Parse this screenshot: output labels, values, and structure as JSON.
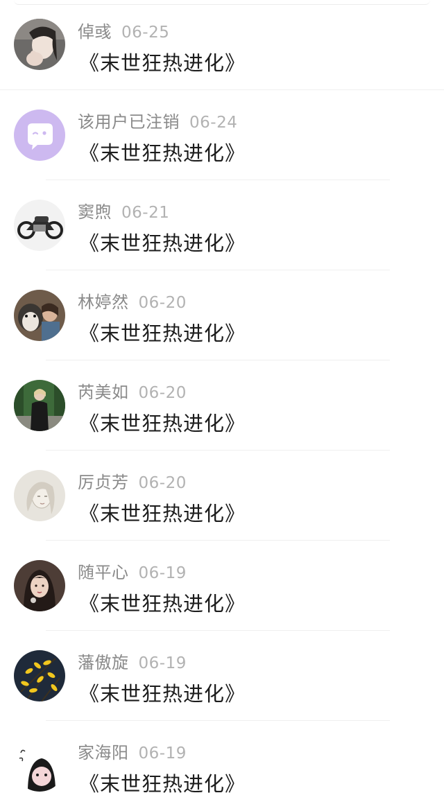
{
  "feed": {
    "items": [
      {
        "name": "倬彧",
        "date": "06-25",
        "title": "《末世狂热进化》",
        "avatar": "avatar-woman-hand-icon",
        "bg": "#6c6a68",
        "fg": "#f0e6e0"
      },
      {
        "name": "该用户已注销",
        "date": "06-24",
        "title": "《末世狂热进化》",
        "avatar": "chat-bubble-icon",
        "bg": "#cdb9f0",
        "fg": "#ffffff"
      },
      {
        "name": "窦煦",
        "date": "06-21",
        "title": "《末世狂热进化》",
        "avatar": "motorcycle-icon",
        "bg": "#f2f2f2",
        "fg": "#2a2a2a"
      },
      {
        "name": "林婷然",
        "date": "06-20",
        "title": "《末世狂热进化》",
        "avatar": "dog-and-girl-icon",
        "bg": "#6e5b4a",
        "fg": "#e9e4de"
      },
      {
        "name": "芮美如",
        "date": "06-20",
        "title": "《末世狂热进化》",
        "avatar": "woman-in-forest-icon",
        "bg": "#3d6a3a",
        "fg": "#1a1a1a"
      },
      {
        "name": "厉贞芳",
        "date": "06-20",
        "title": "《末世狂热进化》",
        "avatar": "sketch-girl-icon",
        "bg": "#e7e4dd",
        "fg": "#a8a39a"
      },
      {
        "name": "随平心",
        "date": "06-19",
        "title": "《末世狂热进化》",
        "avatar": "woman-portrait-icon",
        "bg": "#4d3d36",
        "fg": "#e9d4c6"
      },
      {
        "name": "藩傲旋",
        "date": "06-19",
        "title": "《末世狂热进化》",
        "avatar": "yellow-flowers-icon",
        "bg": "#1f2a3a",
        "fg": "#f2c71e"
      },
      {
        "name": "家海阳",
        "date": "06-19",
        "title": "《末世狂热进化》",
        "avatar": "cartoon-ghost-icon",
        "bg": "#ffffff",
        "fg": "#1a1a1a"
      }
    ]
  }
}
